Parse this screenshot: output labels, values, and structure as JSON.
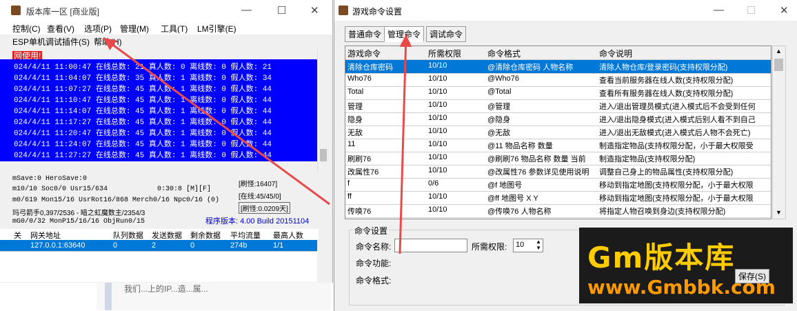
{
  "left_window": {
    "title": "版本库一区 [商业版]",
    "menu": [
      "控制(C)",
      "查看(V)",
      "选项(P)",
      "管理(M)",
      "工具(T)",
      "LM引擎(E)"
    ],
    "menu2": [
      "ESP单机调试插件(S)",
      "帮助(H)"
    ],
    "notice": "网使用!",
    "log_lines": [
      "024/4/11 11:00:47 在线总数: 21 真人数: 0 离线数: 0 假人数: 21",
      "024/4/11 11:04:07 在线总数: 35 真人数: 1 离线数: 0 假人数: 34",
      "024/4/11 11:07:27 在线总数: 45 真人数: 1 离线数: 0 假人数: 44",
      "024/4/11 11:10:47 在线总数: 45 真人数: 1 离线数: 0 假人数: 44",
      "024/4/11 11:14:07 在线总数: 45 真人数: 1 离线数: 0 假人数: 44",
      "024/4/11 11:17:27 在线总数: 45 真人数: 1 离线数: 0 假人数: 44",
      "024/4/11 11:20:47 在线总数: 45 真人数: 1 离线数: 0 假人数: 44",
      "024/4/11 11:24:07 在线总数: 45 真人数: 1 离线数: 0 假人数: 44",
      "024/4/11 11:27:27 在线总数: 45 真人数: 1 离线数: 0 假人数: 44"
    ],
    "stats": {
      "l1": "mSave:0 HeroSave:0",
      "l2": "m10/10 Soc0/0 Usr15/634",
      "l2b": "0:30:8 [M][F]",
      "l3": "m0/619 Mon15/16 UsrRot16/868 Merch0/16 Npc0/16 (0)",
      "l4": "玛弓箭手0,397/2536 - 暗之虹魔数主/2354/3",
      "l5": "mG0/0/32 MonP15/16/16 ObjRun0/15",
      "right1": "[刷怪:16407]",
      "right2": "[在线:45/45/0]",
      "right3": "[刷怪:0.0209天]",
      "version": "程序版本: 4.00 Build 20151104"
    },
    "table": {
      "headers": [
        "关",
        "网关地址",
        "队列数据",
        "发送数据",
        "剩余数据",
        "平均流量",
        "最高人数"
      ],
      "row": [
        "",
        "127.0.0.1:63640",
        "0",
        "2",
        "0",
        "274b",
        "1/1"
      ]
    },
    "bg_text": "我们...上的IP...造...属..."
  },
  "right_window": {
    "title": "游戏命令设置",
    "tabs": [
      "普通命令",
      "管理命令",
      "调试命令"
    ],
    "grid_headers": [
      "游戏命令",
      "所需权限",
      "命令格式",
      "命令说明"
    ],
    "rows": [
      [
        "清除仓库密码",
        "10/10",
        "@清除仓库密码 人物名称",
        "清除人物仓库/登录密码(支持权限分配)"
      ],
      [
        "Who76",
        "10/10",
        "@Who76",
        "查看当前服务器在线人数(支持权限分配)"
      ],
      [
        "Total",
        "10/10",
        "@Total",
        "查看所有服务器在线人数(支持权限分配)"
      ],
      [
        "管理",
        "10/10",
        "@管理",
        "进入/退出管理员模式(进入模式后不会受到任何"
      ],
      [
        "隐身",
        "10/10",
        "@隐身",
        "进入/退出隐身模式(进入模式后别人看不到自己"
      ],
      [
        "无敌",
        "10/10",
        "@无敌",
        "进入/退出无敌模式(进入模式后人物不会死亡)"
      ],
      [
        "11",
        "10/10",
        "@11 物品名称 数量",
        "制造指定物品(支持权限分配，小于最大权限受"
      ],
      [
        "刷刷76",
        "10/10",
        "@刷刷76 物品名称 数量 当前",
        "制造指定物品(支持权限分配)"
      ],
      [
        "改属性76",
        "10/10",
        "@改属性76 参数详见使用说明",
        "调整自己身上的物品属性(支持权限分配)"
      ],
      [
        "f",
        "0/6",
        "@f 地图号",
        "移动到指定地图(支持权限分配，小于最大权限"
      ],
      [
        "ff",
        "10/10",
        "@ff 地图号 X Y",
        "移动到指定地图(支持权限分配，小于最大权限"
      ],
      [
        "传唤76",
        "10/10",
        "@传唤76 人物名称",
        "将指定人物召唤到身边(支持权限分配)"
      ]
    ],
    "group_title": "命令设置",
    "name_label": "命令名称:",
    "perm_label": "所需权限:",
    "perm_value": "10",
    "func_label": "命令功能:",
    "format_label": "命令格式:",
    "save_label": "保存(S)"
  },
  "watermark": {
    "main": "Gm版本库",
    "url": "www.Gmbbk.com"
  },
  "colors": {
    "log_bg": "#0000ff",
    "selection": "#0078d7",
    "arrow": "#e84a4a"
  }
}
